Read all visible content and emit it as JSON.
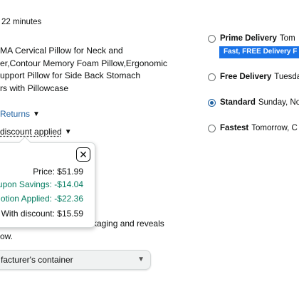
{
  "timer_text": "22 minutes",
  "product_title": "MA Cervical Pillow for Neck and er,Contour Memory Foam Pillow,Ergonomic upport Pillow for Side Back Stomach rs with Pillowcase",
  "product_title_lines": [
    "MA Cervical Pillow for Neck and",
    "er,Contour Memory Foam Pillow,Ergonomic",
    "upport Pillow for Side Back Stomach",
    "rs with Pillowcase"
  ],
  "returns_label": "Returns",
  "discount_label": "discount applied",
  "popover": {
    "price": "Price: $51.99",
    "coupon": "upon Savings: -$14.04",
    "promo": "otion Applied: -$22.36",
    "final": "With discount: $15.59",
    "close_symbol": "✕"
  },
  "packaging_line1": "kaging and reveals",
  "packaging_line2": "ow.",
  "container_select": {
    "value": "facturer's container"
  },
  "delivery": {
    "options": [
      {
        "name": "Prime Delivery",
        "detail": "Tom",
        "checked": false
      },
      {
        "name": "Free Delivery",
        "detail": "Tuesda",
        "checked": false
      },
      {
        "name": "Standard",
        "detail": "Sunday, No",
        "checked": true
      },
      {
        "name": "Fastest",
        "detail": "Tomorrow, C",
        "checked": false
      }
    ],
    "badge_text": "Fast, FREE Delivery  F"
  },
  "colors": {
    "link_blue": "#2162a1",
    "savings_green": "#067d62",
    "badge_blue": "#1a73e8",
    "text": "#0f1111"
  },
  "icons": {
    "returns_chevron": "chevron-down-icon",
    "discount_chevron": "chevron-down-icon",
    "select_chevron": "chevron-down-icon",
    "close": "close-icon"
  }
}
